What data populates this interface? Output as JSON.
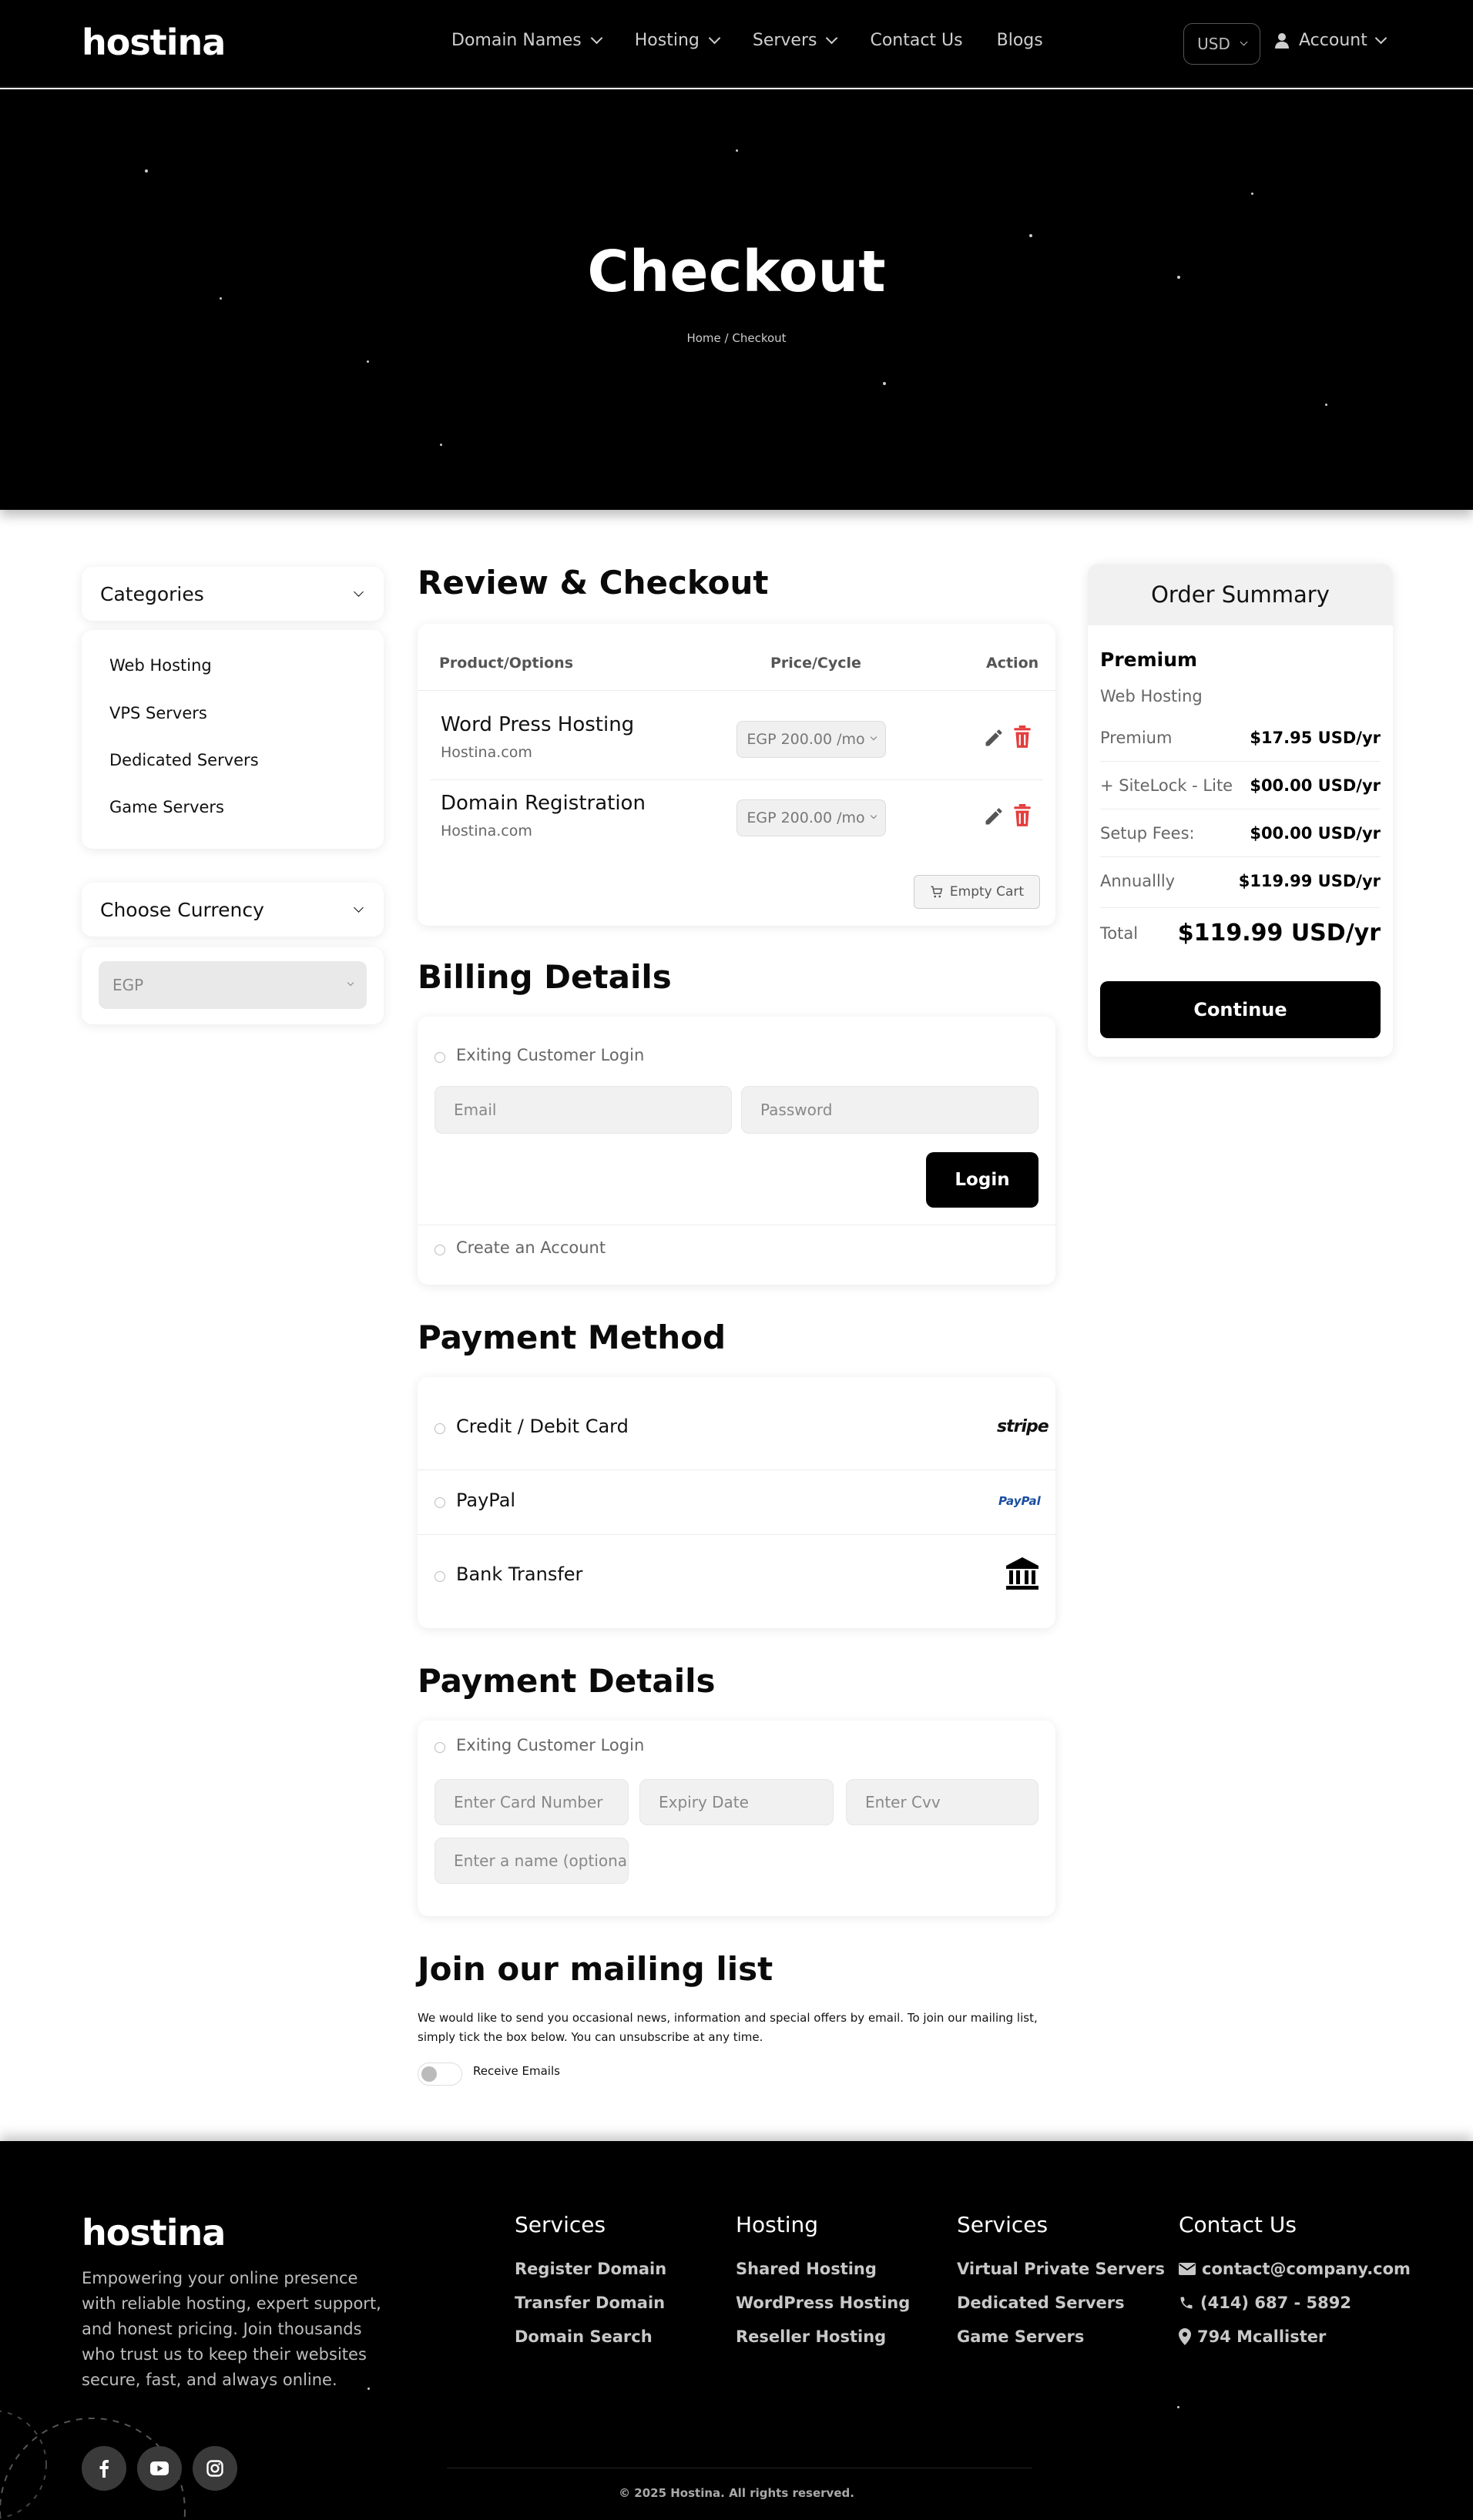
{
  "nav": {
    "logo": "hostina",
    "menu": [
      "Domain Names",
      "Hosting",
      "Servers",
      "Contact Us",
      "Blogs"
    ],
    "currency": "USD",
    "account": "Account"
  },
  "hero": {
    "title": "Checkout",
    "breadcrumb_home": "Home",
    "breadcrumb_sep": "/",
    "breadcrumb_current": "Checkout"
  },
  "sidebar": {
    "categories_title": "Categories",
    "categories": [
      "Web Hosting",
      "VPS Servers",
      "Dedicated Servers",
      "Game Servers"
    ],
    "currency_title": "Choose Currency",
    "currency_value": "EGP"
  },
  "review": {
    "title": "Review & Checkout",
    "col_product": "Product/Options",
    "col_price": "Price/Cycle",
    "col_action": "Action",
    "items": [
      {
        "name": "Word Press Hosting",
        "sub": "Hostina.com",
        "price": "EGP 200.00 /mo"
      },
      {
        "name": "Domain Registration",
        "sub": "Hostina.com",
        "price": "EGP 200.00 /mo"
      }
    ],
    "empty_cart": "Empty Cart"
  },
  "billing": {
    "title": "Billing Details",
    "existing_login": "Exiting Customer Login",
    "email_placeholder": "Email",
    "password_placeholder": "Password",
    "login_button": "Login",
    "create_account": "Create an Account"
  },
  "payment_method": {
    "title": "Payment Method",
    "options": [
      {
        "label": "Credit / Debit Card",
        "logo": "stripe"
      },
      {
        "label": "PayPal",
        "logo": "PayPal"
      },
      {
        "label": "Bank Transfer",
        "logo": "bank-icon"
      }
    ]
  },
  "payment_details": {
    "title": "Payment Details",
    "existing_login": "Exiting Customer Login",
    "card_number": "Enter Card Number",
    "expiry": "Expiry Date",
    "cvv": "Enter Cvv",
    "name": "Enter a name (optional)"
  },
  "mailing": {
    "title": "Join our mailing list",
    "text": "We would like to send you occasional news, information and special offers by email. To join our mailing list, simply tick the box below. You can unsubscribe at any time.",
    "toggle_label": "Receive Emails",
    "toggle_on": false
  },
  "summary": {
    "title": "Order Summary",
    "plan": "Premium",
    "plan_type": "Web Hosting",
    "rows": [
      {
        "label": "Premium",
        "value": "$17.95 USD/yr"
      },
      {
        "label": "+ SiteLock - Lite",
        "value": "$00.00 USD/yr"
      },
      {
        "label": "Setup Fees:",
        "value": "$00.00 USD/yr"
      },
      {
        "label": "Annuallly",
        "value": "$119.99 USD/yr"
      }
    ],
    "total_label": "Total",
    "total_value": "$119.99 USD/yr",
    "continue": "Continue"
  },
  "footer": {
    "logo": "hostina",
    "about": "Empowering your online presence with reliable hosting, expert support, and honest pricing. Join thousands who trust us to keep their websites secure, fast, and always online.",
    "columns": [
      {
        "title": "Services",
        "links": [
          "Register Domain",
          "Transfer Domain",
          "Domain Search"
        ]
      },
      {
        "title": "Hosting",
        "links": [
          "Shared Hosting",
          "WordPress Hosting",
          "Reseller Hosting"
        ]
      },
      {
        "title": "Services",
        "links": [
          "Virtual Private Servers",
          "Dedicated Servers",
          "Game Servers"
        ]
      }
    ],
    "contact_title": "Contact Us",
    "contact": {
      "email": "contact@company.com",
      "phone": "(414) 687 - 5892",
      "address": "794 Mcallister"
    },
    "copyright": "© 2025 Hostina. All rights reserved.",
    "socials": [
      "facebook-icon",
      "youtube-icon",
      "instagram-icon"
    ]
  }
}
